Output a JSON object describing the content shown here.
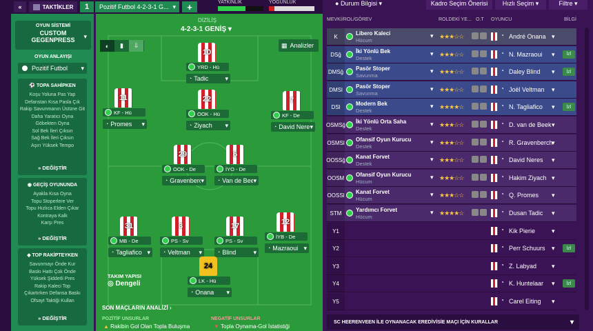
{
  "topbar": {
    "tactics_label": "TAKTİKLER",
    "slot": "1",
    "formation_name": "Pozitif Futbol 4-2-3-1 G...",
    "add": "+",
    "fitness_label": "YATKINLIK",
    "familiarity_label": "YOĞUNLUK"
  },
  "left": {
    "system_heading": "OYUN SİSTEMİ",
    "system_value": "CUSTOM GEGENPRESS",
    "mentality_heading": "OYUN ANLAYIŞI",
    "mentality_value": "Pozitif Futbol",
    "possession_title": "TOPA SAHİPKEN",
    "possession_items": [
      "Koşu Yoluna Pas Yap",
      "Defanstan Kısa Pasla Çık",
      "Rakip Savunmanın Üstüne Git",
      "Daha Yaratıcı Oyna",
      "Göbekten Oyna",
      "Sol Bek İleri Çıksın",
      "Sağ Bek İleri Çıksın",
      "Aşırı Yüksek Tempo"
    ],
    "change1": "DEĞİŞTİR",
    "transition_title": "GEÇİŞ OYUNUNDA",
    "transition_items": [
      "Ayakla Kısa Oyna",
      "Topu Stoperlere Ver",
      "Topu Hızlıca Elden Çıkar",
      "Kontraya Kalk",
      "Karşı Pres"
    ],
    "change2": "DEĞİŞTİR",
    "oop_title": "TOP RAKİPTEYKEN",
    "oop_items": [
      "Savunmayı Önde Kur",
      "Baskı Hattı Çok Önde",
      "Yüksek Şiddetli Pres",
      "Rakip Kaleci Top",
      "Çıkartırken Defansa Baskı",
      "Ofsayt Taktiği Kullan"
    ],
    "change3": "DEĞİŞTİR"
  },
  "pitch": {
    "dizilis_label": "DİZİLİŞ",
    "formation": "4-2-3-1 GENİŞ",
    "analyze": "Analizler",
    "team_shape_label": "TAKIM YAPISI",
    "team_shape_value": "Dengeli",
    "recent_label": "SON MAÇLARIN ANALİZİ",
    "positive_label": "POZİTİF UNSURLAR",
    "negative_label": "NEGATİF UNSURLAR",
    "positive_item": "Rakibin Gol Olan Topla Buluşma",
    "negative_item": "Topla Oynama-Gol İstatistiği",
    "players": [
      {
        "num": "10",
        "role": "YRD - Hü",
        "name": "Tadic"
      },
      {
        "num": "11",
        "role": "KF - Hü",
        "name": "Promes"
      },
      {
        "num": "22",
        "role": "OOK - Hü",
        "name": "Ziyach"
      },
      {
        "num": "7",
        "role": "KF - De",
        "name": "David Neres"
      },
      {
        "num": "29",
        "role": "OOK - De",
        "name": "Gravenberch"
      },
      {
        "num": "6",
        "role": "İYO - De",
        "name": "Van de Beek"
      },
      {
        "num": "31",
        "role": "MB - De",
        "name": "Tagliafico"
      },
      {
        "num": "3",
        "role": "PS - Sv",
        "name": "Veltman"
      },
      {
        "num": "17",
        "role": "PS - Sv",
        "name": "Blind"
      },
      {
        "num": "12",
        "role": "İYB - De",
        "name": "Mazraoui"
      },
      {
        "num": "24",
        "role": "LK - Hü",
        "name": "Onana"
      }
    ]
  },
  "right": {
    "info_btn": "Durum Bilgisi",
    "squad_suggest": "Kadro Seçim Önerisi",
    "quick_select": "Hızlı Seçim",
    "filter": "Filtre",
    "col_pos": "MEVKİ/ROL/GÖREV",
    "col_role": "ROLDEKİ YE...",
    "col_ot": "O.T",
    "col_player": "OYUNCU",
    "col_info": "BİLGİ",
    "rows": [
      {
        "pos": "K",
        "role": "Libero Kaleci",
        "duty": "Hücum",
        "stars": 3,
        "player": "André Onana",
        "info": ""
      },
      {
        "pos": "DSğ",
        "role": "İki Yönlü Bek",
        "duty": "Destek",
        "stars": 3,
        "player": "N. Mazraoui",
        "info": "lzl"
      },
      {
        "pos": "DMSğ",
        "role": "Pasör Stoper",
        "duty": "Savunma",
        "stars": 3,
        "player": "Daley Blind",
        "info": "lzl"
      },
      {
        "pos": "DMSl",
        "role": "Pasör Stoper",
        "duty": "Savunma",
        "stars": 3,
        "player": "Joël Veltman",
        "info": ""
      },
      {
        "pos": "DSl",
        "role": "Modern Bek",
        "duty": "Destek",
        "stars": 4,
        "player": "N. Tagliafico",
        "info": "lzl"
      },
      {
        "pos": "OSMSğ",
        "role": "İki Yönlü Orta Saha",
        "duty": "Destek",
        "stars": 3,
        "player": "D. van de Beek",
        "info": ""
      },
      {
        "pos": "OSMSl",
        "role": "Ofansif Oyun Kurucu",
        "duty": "Destek",
        "stars": 3,
        "player": "R. Gravenberch",
        "info": ""
      },
      {
        "pos": "OOSSğ",
        "role": "Kanat Forvet",
        "duty": "Destek",
        "stars": 3,
        "player": "David Neres",
        "info": ""
      },
      {
        "pos": "OOSM",
        "role": "Ofansif Oyun Kurucu",
        "duty": "Hücum",
        "stars": 3,
        "player": "Hakim Ziyach",
        "info": ""
      },
      {
        "pos": "OOSSl",
        "role": "Kanat Forvet",
        "duty": "Hücum",
        "stars": 3,
        "player": "Q. Promes",
        "info": ""
      },
      {
        "pos": "STM",
        "role": "Yardımcı Forvet",
        "duty": "Hücum",
        "stars": 4,
        "player": "Dusan Tadic",
        "info": ""
      },
      {
        "pos": "Y1",
        "role": "",
        "duty": "",
        "stars": 0,
        "player": "Kik Pierie",
        "info": ""
      },
      {
        "pos": "Y2",
        "role": "",
        "duty": "",
        "stars": 0,
        "player": "Perr Schuurs",
        "info": "lzl"
      },
      {
        "pos": "Y3",
        "role": "",
        "duty": "",
        "stars": 0,
        "player": "Z. Labyad",
        "info": ""
      },
      {
        "pos": "Y4",
        "role": "",
        "duty": "",
        "stars": 0,
        "player": "K. Huntelaar",
        "info": "lzl"
      },
      {
        "pos": "Y5",
        "role": "",
        "duty": "",
        "stars": 0,
        "player": "Carel Eiting",
        "info": ""
      }
    ],
    "footer": "SC HEERENVEEN İLE OYNANACAK EREDİVİSİE MAÇI İÇİN KURALLAR"
  }
}
